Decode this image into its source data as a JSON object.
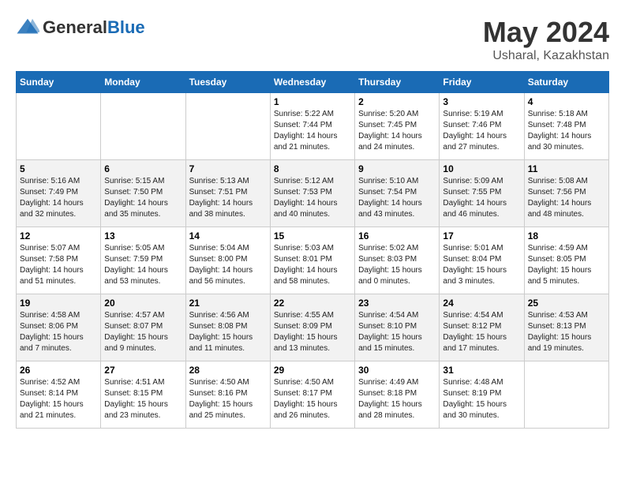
{
  "header": {
    "logo_general": "General",
    "logo_blue": "Blue",
    "title": "May 2024",
    "subtitle": "Usharal, Kazakhstan"
  },
  "days_of_week": [
    "Sunday",
    "Monday",
    "Tuesday",
    "Wednesday",
    "Thursday",
    "Friday",
    "Saturday"
  ],
  "weeks": [
    [
      {
        "day": "",
        "info": ""
      },
      {
        "day": "",
        "info": ""
      },
      {
        "day": "",
        "info": ""
      },
      {
        "day": "1",
        "info": "Sunrise: 5:22 AM\nSunset: 7:44 PM\nDaylight: 14 hours\nand 21 minutes."
      },
      {
        "day": "2",
        "info": "Sunrise: 5:20 AM\nSunset: 7:45 PM\nDaylight: 14 hours\nand 24 minutes."
      },
      {
        "day": "3",
        "info": "Sunrise: 5:19 AM\nSunset: 7:46 PM\nDaylight: 14 hours\nand 27 minutes."
      },
      {
        "day": "4",
        "info": "Sunrise: 5:18 AM\nSunset: 7:48 PM\nDaylight: 14 hours\nand 30 minutes."
      }
    ],
    [
      {
        "day": "5",
        "info": "Sunrise: 5:16 AM\nSunset: 7:49 PM\nDaylight: 14 hours\nand 32 minutes."
      },
      {
        "day": "6",
        "info": "Sunrise: 5:15 AM\nSunset: 7:50 PM\nDaylight: 14 hours\nand 35 minutes."
      },
      {
        "day": "7",
        "info": "Sunrise: 5:13 AM\nSunset: 7:51 PM\nDaylight: 14 hours\nand 38 minutes."
      },
      {
        "day": "8",
        "info": "Sunrise: 5:12 AM\nSunset: 7:53 PM\nDaylight: 14 hours\nand 40 minutes."
      },
      {
        "day": "9",
        "info": "Sunrise: 5:10 AM\nSunset: 7:54 PM\nDaylight: 14 hours\nand 43 minutes."
      },
      {
        "day": "10",
        "info": "Sunrise: 5:09 AM\nSunset: 7:55 PM\nDaylight: 14 hours\nand 46 minutes."
      },
      {
        "day": "11",
        "info": "Sunrise: 5:08 AM\nSunset: 7:56 PM\nDaylight: 14 hours\nand 48 minutes."
      }
    ],
    [
      {
        "day": "12",
        "info": "Sunrise: 5:07 AM\nSunset: 7:58 PM\nDaylight: 14 hours\nand 51 minutes."
      },
      {
        "day": "13",
        "info": "Sunrise: 5:05 AM\nSunset: 7:59 PM\nDaylight: 14 hours\nand 53 minutes."
      },
      {
        "day": "14",
        "info": "Sunrise: 5:04 AM\nSunset: 8:00 PM\nDaylight: 14 hours\nand 56 minutes."
      },
      {
        "day": "15",
        "info": "Sunrise: 5:03 AM\nSunset: 8:01 PM\nDaylight: 14 hours\nand 58 minutes."
      },
      {
        "day": "16",
        "info": "Sunrise: 5:02 AM\nSunset: 8:03 PM\nDaylight: 15 hours\nand 0 minutes."
      },
      {
        "day": "17",
        "info": "Sunrise: 5:01 AM\nSunset: 8:04 PM\nDaylight: 15 hours\nand 3 minutes."
      },
      {
        "day": "18",
        "info": "Sunrise: 4:59 AM\nSunset: 8:05 PM\nDaylight: 15 hours\nand 5 minutes."
      }
    ],
    [
      {
        "day": "19",
        "info": "Sunrise: 4:58 AM\nSunset: 8:06 PM\nDaylight: 15 hours\nand 7 minutes."
      },
      {
        "day": "20",
        "info": "Sunrise: 4:57 AM\nSunset: 8:07 PM\nDaylight: 15 hours\nand 9 minutes."
      },
      {
        "day": "21",
        "info": "Sunrise: 4:56 AM\nSunset: 8:08 PM\nDaylight: 15 hours\nand 11 minutes."
      },
      {
        "day": "22",
        "info": "Sunrise: 4:55 AM\nSunset: 8:09 PM\nDaylight: 15 hours\nand 13 minutes."
      },
      {
        "day": "23",
        "info": "Sunrise: 4:54 AM\nSunset: 8:10 PM\nDaylight: 15 hours\nand 15 minutes."
      },
      {
        "day": "24",
        "info": "Sunrise: 4:54 AM\nSunset: 8:12 PM\nDaylight: 15 hours\nand 17 minutes."
      },
      {
        "day": "25",
        "info": "Sunrise: 4:53 AM\nSunset: 8:13 PM\nDaylight: 15 hours\nand 19 minutes."
      }
    ],
    [
      {
        "day": "26",
        "info": "Sunrise: 4:52 AM\nSunset: 8:14 PM\nDaylight: 15 hours\nand 21 minutes."
      },
      {
        "day": "27",
        "info": "Sunrise: 4:51 AM\nSunset: 8:15 PM\nDaylight: 15 hours\nand 23 minutes."
      },
      {
        "day": "28",
        "info": "Sunrise: 4:50 AM\nSunset: 8:16 PM\nDaylight: 15 hours\nand 25 minutes."
      },
      {
        "day": "29",
        "info": "Sunrise: 4:50 AM\nSunset: 8:17 PM\nDaylight: 15 hours\nand 26 minutes."
      },
      {
        "day": "30",
        "info": "Sunrise: 4:49 AM\nSunset: 8:18 PM\nDaylight: 15 hours\nand 28 minutes."
      },
      {
        "day": "31",
        "info": "Sunrise: 4:48 AM\nSunset: 8:19 PM\nDaylight: 15 hours\nand 30 minutes."
      },
      {
        "day": "",
        "info": ""
      }
    ]
  ]
}
